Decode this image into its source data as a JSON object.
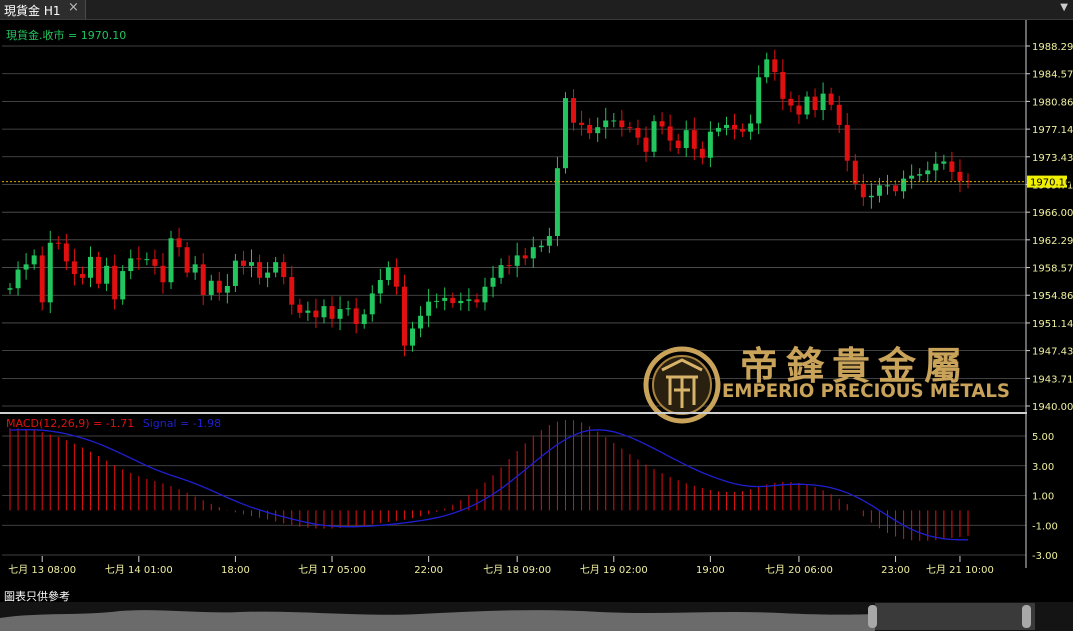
{
  "window": {
    "tab_title": "現貨金 H1",
    "close_glyph": "×",
    "menu_glyph": "▼"
  },
  "chart_info": {
    "close_label": "現貨金.收市 = 1970.10",
    "macd_label": "MACD(12,26,9) = -1.71",
    "signal_label": "Signal = -1.98",
    "current_price": "1970.10"
  },
  "watermark": {
    "chinese_name": "帝鋒貴金屬",
    "english_name": "EMPERIO PRECIOUS METALS"
  },
  "footer": {
    "note": "圖表只供參考"
  },
  "colors": {
    "background": "#000000",
    "up_candle": "#22c55e",
    "down_candle": "#e01010",
    "macd_bar": "#e01010",
    "signal_line": "#1f1fd0",
    "price_label": "#f0f000",
    "grid": "#555555",
    "watermark_gold": "#c9a35a"
  },
  "chart_data": [
    {
      "type": "candlestick",
      "symbol": "現貨金",
      "timeframe": "H1",
      "last_close": 1970.1,
      "y_ticks": [
        "1988.29",
        "1984.57",
        "1980.86",
        "1977.14",
        "1973.43",
        "1969.71",
        "1966.00",
        "1962.29",
        "1958.57",
        "1954.86",
        "1951.14",
        "1947.43",
        "1943.71",
        "1940.00"
      ],
      "ylim": [
        1940.0,
        1990.0
      ],
      "x_ticks": [
        "七月 13 08:00",
        "七月 14 01:00",
        "18:00",
        "七月 17 05:00",
        "22:00",
        "七月 18 09:00",
        "七月 19 02:00",
        "19:00",
        "七月 20 06:00",
        "23:00",
        "七月 21 10:00"
      ],
      "closes": [
        1955.8,
        1958.3,
        1959.0,
        1960.2,
        1953.9,
        1961.9,
        1961.8,
        1959.4,
        1957.7,
        1957.2,
        1960.0,
        1956.4,
        1958.8,
        1954.3,
        1958.1,
        1959.8,
        1959.7,
        1959.7,
        1958.8,
        1956.6,
        1962.5,
        1961.3,
        1957.9,
        1959.0,
        1954.9,
        1956.8,
        1955.2,
        1956.1,
        1959.5,
        1958.8,
        1959.3,
        1957.2,
        1957.9,
        1959.3,
        1957.3,
        1953.6,
        1952.5,
        1952.8,
        1951.9,
        1953.4,
        1951.7,
        1953.0,
        1953.1,
        1951.0,
        1952.3,
        1955.1,
        1956.9,
        1958.6,
        1956.0,
        1948.1,
        1950.4,
        1952.1,
        1954.0,
        1954.1,
        1954.5,
        1953.8,
        1954.1,
        1954.3,
        1953.9,
        1956.0,
        1957.2,
        1958.9,
        1958.8,
        1960.2,
        1959.8,
        1961.3,
        1961.5,
        1962.8,
        1971.9,
        1981.3,
        1978.0,
        1977.7,
        1976.6,
        1977.4,
        1978.3,
        1978.3,
        1977.4,
        1977.3,
        1976.0,
        1974.1,
        1978.2,
        1977.5,
        1975.6,
        1974.6,
        1977.0,
        1974.5,
        1973.3,
        1976.8,
        1977.3,
        1977.7,
        1977.1,
        1976.8,
        1977.9,
        1984.1,
        1986.5,
        1984.8,
        1981.2,
        1980.3,
        1979.1,
        1981.5,
        1979.7,
        1981.9,
        1980.4,
        1977.7,
        1972.9,
        1969.8,
        1968.0,
        1968.2,
        1969.6,
        1969.6,
        1968.8,
        1970.5,
        1970.9,
        1971.1,
        1971.6,
        1972.5,
        1972.8,
        1971.4,
        1970.2,
        1970.1
      ]
    },
    {
      "type": "macd",
      "params": "12,26,9",
      "macd": -1.71,
      "signal": -1.98,
      "y_ticks": [
        "5.00",
        "3.00",
        "1.00",
        "-1.00",
        "-3.00"
      ],
      "ylim": [
        -3.5,
        6.0
      ],
      "histogram": [
        5.52,
        5.51,
        5.46,
        5.37,
        5.25,
        5.1,
        4.93,
        4.72,
        4.49,
        4.23,
        3.95,
        3.65,
        3.34,
        3.04,
        2.76,
        2.52,
        2.3,
        2.12,
        1.97,
        1.81,
        1.63,
        1.42,
        1.18,
        0.93,
        0.68,
        0.44,
        0.22,
        0.03,
        -0.13,
        -0.26,
        -0.38,
        -0.5,
        -0.62,
        -0.75,
        -0.88,
        -1.0,
        -1.1,
        -1.17,
        -1.22,
        -1.23,
        -1.22,
        -1.19,
        -1.14,
        -1.08,
        -1.01,
        -0.93,
        -0.86,
        -0.78,
        -0.7,
        -0.62,
        -0.52,
        -0.4,
        -0.26,
        -0.09,
        0.12,
        0.38,
        0.68,
        1.03,
        1.43,
        1.87,
        2.36,
        2.89,
        3.44,
        3.99,
        4.51,
        4.99,
        5.4,
        5.73,
        5.96,
        6.07,
        6.06,
        5.92,
        5.65,
        5.3,
        4.92,
        4.53,
        4.15,
        3.78,
        3.42,
        3.08,
        2.78,
        2.5,
        2.25,
        2.02,
        1.82,
        1.65,
        1.5,
        1.37,
        1.28,
        1.23,
        1.24,
        1.3,
        1.42,
        1.58,
        1.74,
        1.86,
        1.92,
        1.91,
        1.84,
        1.72,
        1.56,
        1.35,
        1.09,
        0.78,
        0.42,
        0.02,
        -0.4,
        -0.82,
        -1.2,
        -1.52,
        -1.76,
        -1.92,
        -2.01,
        -2.05,
        -2.04,
        -2.0,
        -1.93,
        -1.86,
        -1.79,
        -1.71
      ],
      "signal_line": [
        5.4,
        5.42,
        5.43,
        5.42,
        5.39,
        5.33,
        5.25,
        5.14,
        5.01,
        4.86,
        4.68,
        4.48,
        4.26,
        4.02,
        3.77,
        3.51,
        3.25,
        3.0,
        2.76,
        2.55,
        2.36,
        2.18,
        2.0,
        1.8,
        1.58,
        1.34,
        1.1,
        0.86,
        0.63,
        0.41,
        0.21,
        0.03,
        -0.14,
        -0.3,
        -0.44,
        -0.58,
        -0.71,
        -0.83,
        -0.93,
        -1.01,
        -1.06,
        -1.09,
        -1.1,
        -1.1,
        -1.08,
        -1.05,
        -1.01,
        -0.96,
        -0.9,
        -0.84,
        -0.77,
        -0.69,
        -0.6,
        -0.49,
        -0.36,
        -0.2,
        -0.01,
        0.21,
        0.47,
        0.76,
        1.09,
        1.46,
        1.86,
        2.29,
        2.73,
        3.18,
        3.62,
        4.04,
        4.43,
        4.77,
        5.05,
        5.26,
        5.38,
        5.42,
        5.38,
        5.28,
        5.12,
        4.92,
        4.69,
        4.43,
        4.16,
        3.88,
        3.59,
        3.31,
        3.04,
        2.78,
        2.54,
        2.32,
        2.12,
        1.94,
        1.79,
        1.68,
        1.62,
        1.6,
        1.62,
        1.67,
        1.72,
        1.75,
        1.76,
        1.74,
        1.7,
        1.63,
        1.52,
        1.37,
        1.18,
        0.94,
        0.66,
        0.34,
        0.0,
        -0.35,
        -0.69,
        -1.0,
        -1.28,
        -1.51,
        -1.69,
        -1.82,
        -1.91,
        -1.96,
        -1.98,
        -1.98
      ]
    }
  ]
}
